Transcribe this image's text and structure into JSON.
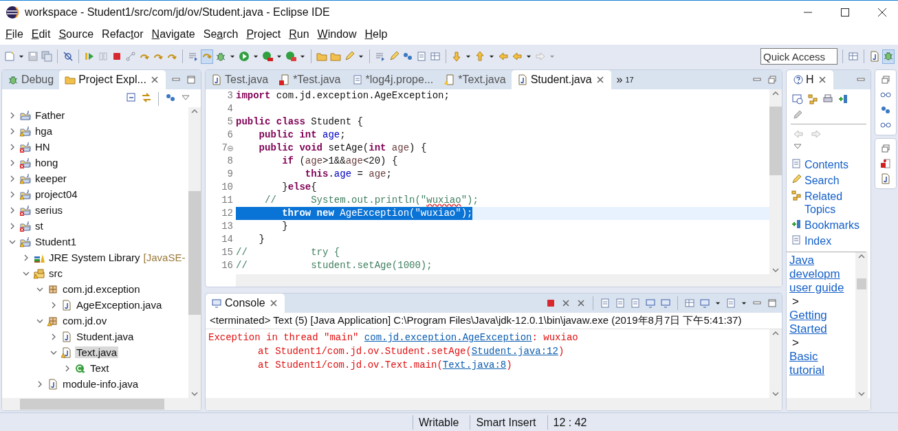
{
  "window": {
    "title": "workspace - Student1/src/com/jd/ov/Student.java - Eclipse IDE"
  },
  "menu": [
    {
      "parts": [
        {
          "text": "F",
          "underlined": true
        },
        {
          "text": "ile",
          "underlined": false
        }
      ]
    },
    {
      "parts": [
        {
          "text": "E",
          "underlined": true
        },
        {
          "text": "dit",
          "underlined": false
        }
      ]
    },
    {
      "parts": [
        {
          "text": "S",
          "underlined": true
        },
        {
          "text": "ource",
          "underlined": false
        }
      ]
    },
    {
      "parts": [
        {
          "text": "Refac",
          "underlined": false
        },
        {
          "text": "t",
          "underlined": true
        },
        {
          "text": "or",
          "underlined": false
        }
      ]
    },
    {
      "parts": [
        {
          "text": "N",
          "underlined": true
        },
        {
          "text": "avigate",
          "underlined": false
        }
      ]
    },
    {
      "parts": [
        {
          "text": "Se",
          "underlined": false
        },
        {
          "text": "a",
          "underlined": true
        },
        {
          "text": "rch",
          "underlined": false
        }
      ]
    },
    {
      "parts": [
        {
          "text": "P",
          "underlined": true
        },
        {
          "text": "roject",
          "underlined": false
        }
      ]
    },
    {
      "parts": [
        {
          "text": "R",
          "underlined": true
        },
        {
          "text": "un",
          "underlined": false
        }
      ]
    },
    {
      "parts": [
        {
          "text": "W",
          "underlined": true
        },
        {
          "text": "indow",
          "underlined": false
        }
      ]
    },
    {
      "parts": [
        {
          "text": "H",
          "underlined": true
        },
        {
          "text": "elp",
          "underlined": false
        }
      ]
    }
  ],
  "quick_access": {
    "placeholder": "Quick Access"
  },
  "left_panel": {
    "tabs": [
      {
        "label": "Debug",
        "selected": false,
        "kind": "debug"
      },
      {
        "label": "Project Expl...",
        "selected": true,
        "kind": "explorer"
      }
    ],
    "tree": [
      {
        "label": "Father",
        "kind": "project",
        "warning": false,
        "error": false,
        "expanded": false,
        "selected": false
      },
      {
        "label": "hga",
        "kind": "project",
        "warning": true,
        "error": false,
        "expanded": false,
        "selected": false
      },
      {
        "label": "HN",
        "kind": "project",
        "warning": false,
        "error": true,
        "expanded": false,
        "selected": false
      },
      {
        "label": "hong",
        "kind": "project",
        "warning": false,
        "error": true,
        "expanded": false,
        "selected": false
      },
      {
        "label": "keeper",
        "kind": "project",
        "warning": true,
        "error": false,
        "expanded": false,
        "selected": false
      },
      {
        "label": "project04",
        "kind": "project",
        "warning": true,
        "error": false,
        "expanded": false,
        "selected": false
      },
      {
        "label": "serius",
        "kind": "project",
        "warning": false,
        "error": true,
        "expanded": false,
        "selected": false
      },
      {
        "label": "st",
        "kind": "project",
        "warning": false,
        "error": true,
        "expanded": false,
        "selected": false
      },
      {
        "label": "Student1",
        "kind": "project",
        "warning": true,
        "error": false,
        "expanded": true,
        "selected": false,
        "children": [
          {
            "label": "JRE System Library",
            "suffix": "[JavaSE-",
            "kind": "library",
            "warning": false,
            "error": false,
            "expanded": false,
            "selected": false
          },
          {
            "label": "src",
            "kind": "source",
            "warning": true,
            "error": false,
            "expanded": true,
            "selected": false,
            "children": [
              {
                "label": "com.jd.exception",
                "kind": "package",
                "warning": false,
                "error": false,
                "expanded": true,
                "selected": false,
                "children": [
                  {
                    "label": "AgeException.java",
                    "kind": "java",
                    "warning": false,
                    "error": false,
                    "expanded": false,
                    "selected": false
                  }
                ]
              },
              {
                "label": "com.jd.ov",
                "kind": "package",
                "warning": true,
                "error": false,
                "expanded": true,
                "selected": false,
                "children": [
                  {
                    "label": "Student.java",
                    "kind": "java",
                    "warning": false,
                    "error": false,
                    "expanded": false,
                    "selected": false
                  },
                  {
                    "label": "Text.java",
                    "kind": "java",
                    "warning": true,
                    "error": false,
                    "expanded": true,
                    "selected": true,
                    "children": [
                      {
                        "label": "Text",
                        "kind": "class",
                        "warning": false,
                        "error": false,
                        "expanded": false,
                        "selected": false
                      }
                    ]
                  }
                ]
              },
              {
                "label": "module-info.java",
                "kind": "java",
                "warning": false,
                "error": false,
                "expanded": false,
                "selected": false
              }
            ]
          }
        ]
      }
    ]
  },
  "editor": {
    "tabs": [
      {
        "label": "Test.java",
        "selected": false,
        "kind": "java"
      },
      {
        "label": "*Test.java",
        "selected": false,
        "kind": "java-error"
      },
      {
        "label": "*log4j.prope...",
        "selected": false,
        "kind": "text"
      },
      {
        "label": "*Text.java",
        "selected": false,
        "kind": "java-warning"
      },
      {
        "label": "Student.java",
        "selected": true,
        "kind": "java"
      }
    ],
    "overflow": "»",
    "overflow_count": "17",
    "lines": [
      {
        "num": "3",
        "selected": false,
        "fold": false,
        "tokens": [
          {
            "kind": "keyword",
            "text": "import"
          },
          {
            "kind": "plain",
            "text": " com.jd.exception.AgeException;"
          }
        ]
      },
      {
        "num": "4",
        "selected": false,
        "fold": false
      },
      {
        "num": "5",
        "selected": false,
        "fold": false,
        "tokens": [
          {
            "kind": "keyword",
            "text": "public"
          },
          {
            "kind": "keyword",
            "text": " class"
          },
          {
            "kind": "plain",
            "text": " Student {"
          }
        ]
      },
      {
        "num": "6",
        "selected": false,
        "fold": false,
        "tokens": [
          {
            "kind": "keyword",
            "text": "    public"
          },
          {
            "kind": "keyword",
            "text": " int"
          },
          {
            "kind": "field",
            "text": " age"
          },
          {
            "kind": "plain",
            "text": ";"
          }
        ]
      },
      {
        "num": "7",
        "selected": false,
        "fold": true,
        "tokens": [
          {
            "kind": "keyword",
            "text": "    public"
          },
          {
            "kind": "keyword",
            "text": " void"
          },
          {
            "kind": "plain",
            "text": " setAge("
          },
          {
            "kind": "keyword",
            "text": "int"
          },
          {
            "kind": "local",
            "text": " age"
          },
          {
            "kind": "plain",
            "text": ") {"
          }
        ]
      },
      {
        "num": "8",
        "selected": false,
        "fold": false,
        "tokens": [
          {
            "kind": "keyword",
            "text": "        if"
          },
          {
            "kind": "plain",
            "text": " ("
          },
          {
            "kind": "local",
            "text": "age"
          },
          {
            "kind": "plain",
            "text": ">1&&"
          },
          {
            "kind": "local",
            "text": "age"
          },
          {
            "kind": "plain",
            "text": "<20) {"
          }
        ]
      },
      {
        "num": "9",
        "selected": false,
        "fold": false,
        "tokens": [
          {
            "kind": "keyword",
            "text": "            this"
          },
          {
            "kind": "plain",
            "text": "."
          },
          {
            "kind": "field",
            "text": "age"
          },
          {
            "kind": "plain",
            "text": " = "
          },
          {
            "kind": "local",
            "text": "age"
          },
          {
            "kind": "plain",
            "text": ";"
          }
        ]
      },
      {
        "num": "10",
        "selected": false,
        "fold": false,
        "tokens": [
          {
            "kind": "plain",
            "text": "        }"
          },
          {
            "kind": "keyword",
            "text": "else"
          },
          {
            "kind": "plain",
            "text": "{"
          }
        ]
      },
      {
        "num": "11",
        "selected": false,
        "fold": false,
        "tokens": [
          {
            "kind": "comment",
            "text": "     //      System.out.println(\""
          },
          {
            "kind": "misspelled",
            "text": "wuxiao"
          },
          {
            "kind": "comment",
            "text": "\");"
          }
        ]
      },
      {
        "num": "12",
        "selected": true,
        "fold": false,
        "tokens": [
          {
            "kind": "keyword",
            "text": "        throw"
          },
          {
            "kind": "keyword",
            "text": " new"
          },
          {
            "kind": "plain",
            "text": " AgeException("
          },
          {
            "kind": "string",
            "text": "\"wuxiao\""
          },
          {
            "kind": "plain",
            "text": ");"
          }
        ]
      },
      {
        "num": "13",
        "selected": false,
        "fold": false,
        "tokens": [
          {
            "kind": "plain",
            "text": "        }"
          }
        ]
      },
      {
        "num": "14",
        "selected": false,
        "fold": false,
        "tokens": [
          {
            "kind": "plain",
            "text": "    }"
          }
        ]
      },
      {
        "num": "15",
        "selected": false,
        "fold": false,
        "tokens": [
          {
            "kind": "comment",
            "text": "//           try {"
          }
        ]
      },
      {
        "num": "16",
        "selected": false,
        "fold": false,
        "tokens": [
          {
            "kind": "comment",
            "text": "//           student.setAge(1000);"
          }
        ]
      }
    ]
  },
  "console": {
    "tab": {
      "label": "Console",
      "selected": true
    },
    "info": "<terminated> Text (5) [Java Application] C:\\Program Files\\Java\\jdk-12.0.1\\bin\\javaw.exe (2019年8月7日 下午5:41:37)",
    "lines": [
      {
        "kind": "message",
        "segments": [
          {
            "kind": "text",
            "text": "Exception in thread \"main\" "
          },
          {
            "kind": "link",
            "text": "com.jd.exception.AgeException"
          },
          {
            "kind": "text",
            "text": ": wuxiao"
          }
        ]
      },
      {
        "kind": "frame",
        "segments": [
          {
            "kind": "text",
            "text": "at Student1/com.jd.ov.Student.setAge("
          },
          {
            "kind": "link",
            "text": "Student.java:12"
          },
          {
            "kind": "text",
            "text": ")"
          }
        ]
      },
      {
        "kind": "frame",
        "segments": [
          {
            "kind": "text",
            "text": "at Student1/com.jd.ov.Text.main("
          },
          {
            "kind": "link",
            "text": "Text.java:8"
          },
          {
            "kind": "text",
            "text": ")"
          }
        ]
      }
    ]
  },
  "help": {
    "tab": {
      "label": "H",
      "selected": true
    },
    "nav": [
      {
        "kind": "back",
        "disabled": true
      },
      {
        "kind": "forward",
        "disabled": true
      }
    ],
    "links": [
      {
        "label": "Contents",
        "kind": "contents"
      },
      {
        "label": "Search",
        "kind": "search"
      },
      {
        "label": "Related Topics",
        "kind": "related"
      },
      {
        "label": "Bookmarks",
        "kind": "bookmarks"
      },
      {
        "label": "Index",
        "kind": "index"
      }
    ],
    "crumbs": [
      {
        "kind": "link",
        "text": "Java developm user guide"
      },
      {
        "kind": "separator",
        "text": ">"
      },
      {
        "kind": "link",
        "text": "Getting Started"
      },
      {
        "kind": "separator",
        "text": ">"
      },
      {
        "kind": "link",
        "text": "Basic tutorial"
      }
    ]
  },
  "status_bar": [
    "Writable",
    "Smart Insert",
    "12 : 42"
  ]
}
